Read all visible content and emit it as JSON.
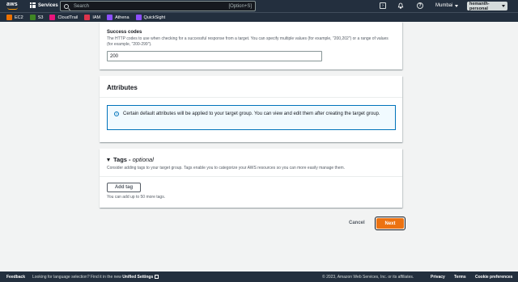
{
  "topnav": {
    "logo_text": "aws",
    "services_label": "Services",
    "search_placeholder": "Search",
    "search_shortcut": "[Option+S]",
    "region": "Mumbai",
    "account": "hemanth-personal"
  },
  "favorites": [
    {
      "label": "EC2",
      "color": "#ed7100"
    },
    {
      "label": "S3",
      "color": "#3f8624"
    },
    {
      "label": "CloudTrail",
      "color": "#e7157b"
    },
    {
      "label": "IAM",
      "color": "#dd344c"
    },
    {
      "label": "Athena",
      "color": "#8c4fff"
    },
    {
      "label": "QuickSight",
      "color": "#8c4fff"
    }
  ],
  "success_codes": {
    "label": "Success codes",
    "description": "The HTTP codes to use when checking for a successful response from a target. You can specify multiple values (for example, \"200,202\") or a range of values (for example, \"200-299\").",
    "value": "200"
  },
  "attributes": {
    "heading": "Attributes",
    "info_text": "Certain default attributes will be applied to your target group. You can view and edit them after creating the target group."
  },
  "tags": {
    "heading": "Tags -",
    "heading_optional": "optional",
    "description": "Consider adding tags to your target group. Tags enable you to categorize your AWS resources so you can more easily manage them.",
    "add_button": "Add tag",
    "hint": "You can add up to 50 more tags."
  },
  "actions": {
    "cancel": "Cancel",
    "next": "Next"
  },
  "footer": {
    "feedback": "Feedback",
    "language_prefix": "Looking for language selection? Find it in the new",
    "language_link": "Unified Settings",
    "copyright": "© 2023, Amazon Web Services, Inc. or its affiliates.",
    "privacy": "Privacy",
    "terms": "Terms",
    "cookie": "Cookie preferences"
  },
  "colors": {
    "nav_bg": "#232f3e",
    "primary_button": "#ec7211",
    "info_border": "#0073bb",
    "info_bg": "#f1faff"
  }
}
